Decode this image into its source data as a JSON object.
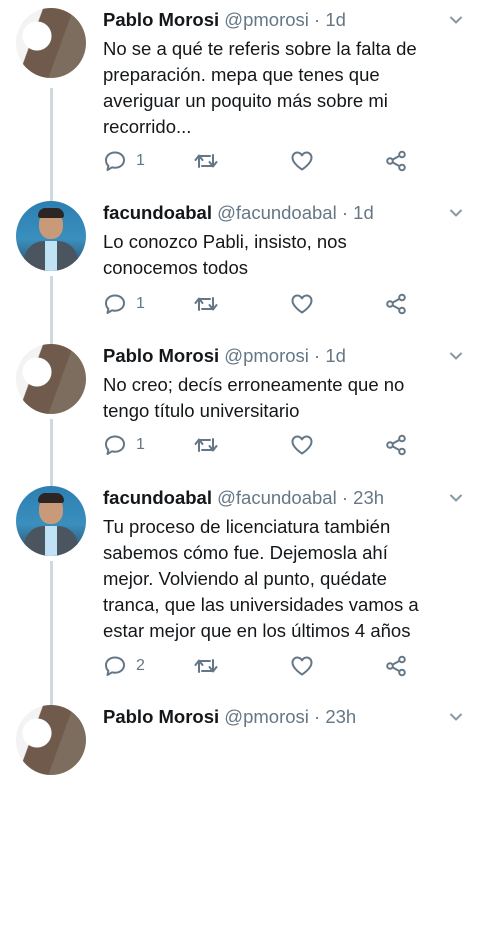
{
  "tweets": [
    {
      "user": "pablo",
      "name": "Pablo Morosi",
      "handle": "@pmorosi",
      "separator": "·",
      "time": "1d",
      "lines": [
        "No se a qué te referis sobre la falta de",
        "preparación. mepa que tenes que",
        "averiguar un poquito más sobre mi",
        "recorrido..."
      ],
      "reply_count": "1"
    },
    {
      "user": "facundo",
      "name": "facundoabal",
      "handle": "@facundoabal",
      "separator": "·",
      "time": "1d",
      "lines": [
        "Lo conozco Pabli, insisto, nos",
        "conocemos todos"
      ],
      "reply_count": "1"
    },
    {
      "user": "pablo",
      "name": "Pablo Morosi",
      "handle": "@pmorosi",
      "separator": "·",
      "time": "1d",
      "lines": [
        "No creo; decís erroneamente que no",
        "tengo título universitario"
      ],
      "reply_count": "1"
    },
    {
      "user": "facundo",
      "name": "facundoabal",
      "handle": "@facundoabal",
      "separator": "·",
      "time": "23h",
      "lines": [
        "Tu proceso de licenciatura también",
        "sabemos cómo fue. Dejemosla ahí",
        "mejor. Volviendo al punto, quédate",
        "tranca, que las universidades vamos a",
        "estar mejor que en los últimos 4 años"
      ],
      "reply_count": "2"
    },
    {
      "user": "pablo",
      "name": "Pablo Morosi",
      "handle": "@pmorosi",
      "separator": "·",
      "time": "23h",
      "lines": [],
      "reply_count": ""
    }
  ],
  "icons": {
    "reply": "reply-icon",
    "retweet": "retweet-icon",
    "like": "heart-icon",
    "share": "share-icon",
    "menu": "chevron-down-icon"
  },
  "colors": {
    "text": "#14171a",
    "secondary": "#657786",
    "thread_line": "#cfd9de"
  }
}
